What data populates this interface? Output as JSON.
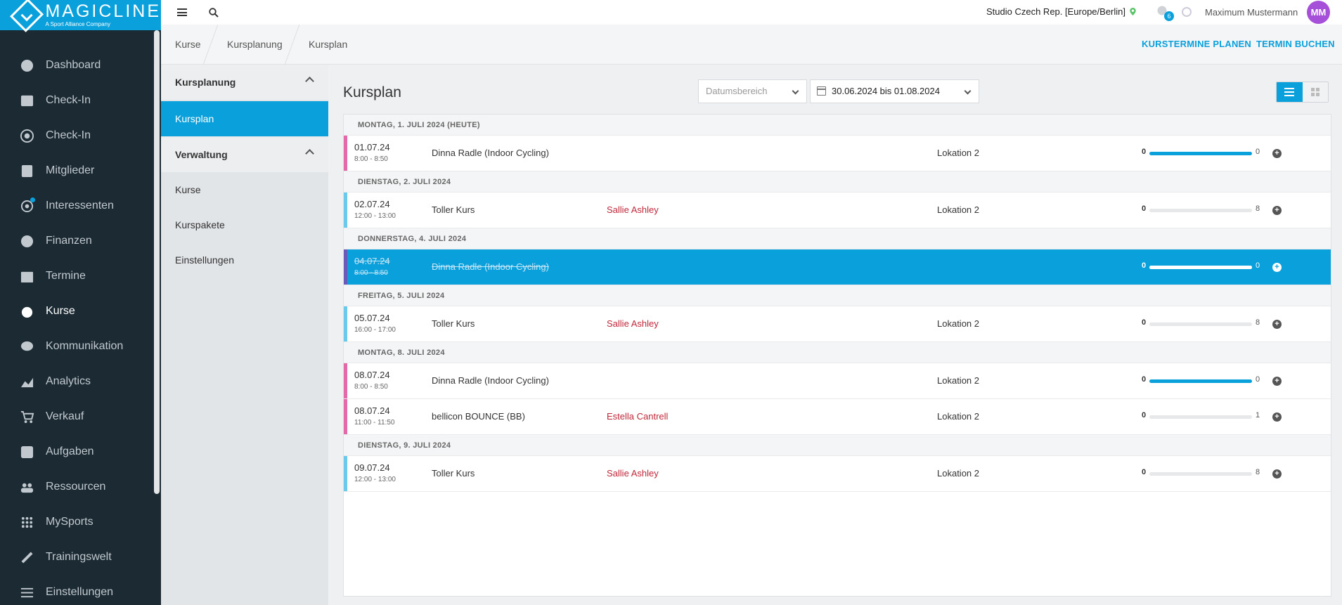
{
  "brand": {
    "name": "MAGICLINE",
    "tagline": "A Sport Alliance Company",
    "accent": "#0aa0dc",
    "sidebar_bg": "#1b2a33"
  },
  "sidebar": {
    "items": [
      {
        "label": "Dashboard",
        "icon": "dashboard-icon"
      },
      {
        "label": "Check-In",
        "icon": "checkin-icon"
      },
      {
        "label": "Check-In",
        "icon": "checkin-target-icon"
      },
      {
        "label": "Mitglieder",
        "icon": "members-icon"
      },
      {
        "label": "Interessenten",
        "icon": "prospects-icon"
      },
      {
        "label": "Finanzen",
        "icon": "euro-icon"
      },
      {
        "label": "Termine",
        "icon": "calendar-icon"
      },
      {
        "label": "Kurse",
        "icon": "courses-icon"
      },
      {
        "label": "Kommunikation",
        "icon": "chat-icon"
      },
      {
        "label": "Analytics",
        "icon": "analytics-icon"
      },
      {
        "label": "Verkauf",
        "icon": "cart-icon"
      },
      {
        "label": "Aufgaben",
        "icon": "tasks-icon"
      },
      {
        "label": "Ressourcen",
        "icon": "resources-icon"
      },
      {
        "label": "MySports",
        "icon": "mysports-icon"
      },
      {
        "label": "Trainingswelt",
        "icon": "training-icon"
      },
      {
        "label": "Einstellungen",
        "icon": "settings-icon"
      }
    ],
    "active": "Kurse"
  },
  "topbar": {
    "studio": "Studio Czech Rep. [Europe/Berlin]",
    "notifications": "6",
    "user": "Maximum Mustermann",
    "avatar": "MM"
  },
  "breadcrumb": [
    "Kurse",
    "Kursplanung",
    "Kursplan"
  ],
  "actions": {
    "plan": "KURSTERMINE PLANEN",
    "book": "TERMIN BUCHEN"
  },
  "subnav": {
    "group1": "Kursplanung",
    "group1_items": [
      "Kursplan"
    ],
    "group2": "Verwaltung",
    "group2_items": [
      "Kurse",
      "Kurspakete",
      "Einstellungen"
    ]
  },
  "main": {
    "title": "Kursplan",
    "date_type_placeholder": "Datumsbereich",
    "date_range": "30.06.2024 bis 01.08.2024"
  },
  "days": [
    {
      "header": "MONTAG, 1. JULI 2024 (HEUTE)",
      "rows": [
        {
          "date": "01.07.24",
          "time": "8:00  -  8:50",
          "name": "Dinna Radle (Indoor Cycling)",
          "trainer": "",
          "location": "Lokation 2",
          "booked": "0",
          "capacity": "0",
          "fill": 1.0,
          "color": "#e36aa9",
          "selected": false
        }
      ]
    },
    {
      "header": "DIENSTAG, 2. JULI 2024",
      "rows": [
        {
          "date": "02.07.24",
          "time": "12:00  -  13:00",
          "name": "Toller Kurs",
          "trainer": "Sallie Ashley",
          "location": "Lokation 2",
          "booked": "0",
          "capacity": "8",
          "fill": 0,
          "color": "#6cc9ec",
          "selected": false
        }
      ]
    },
    {
      "header": "DONNERSTAG, 4. JULI 2024",
      "rows": [
        {
          "date": "04.07.24",
          "time": "8:00  -  8:50",
          "name": "Dinna Radle (Indoor Cycling)",
          "trainer": "",
          "location": "",
          "booked": "0",
          "capacity": "0",
          "fill": 1.0,
          "color": "#6a5bb8",
          "selected": true
        }
      ]
    },
    {
      "header": "FREITAG, 5. JULI 2024",
      "rows": [
        {
          "date": "05.07.24",
          "time": "16:00  -  17:00",
          "name": "Toller Kurs",
          "trainer": "Sallie Ashley",
          "location": "Lokation 2",
          "booked": "0",
          "capacity": "8",
          "fill": 0,
          "color": "#6cc9ec",
          "selected": false
        }
      ]
    },
    {
      "header": "MONTAG, 8. JULI 2024",
      "rows": [
        {
          "date": "08.07.24",
          "time": "8:00  -  8:50",
          "name": "Dinna Radle (Indoor Cycling)",
          "trainer": "",
          "location": "Lokation 2",
          "booked": "0",
          "capacity": "0",
          "fill": 1.0,
          "color": "#e36aa9",
          "selected": false
        },
        {
          "date": "08.07.24",
          "time": "11:00  -  11:50",
          "name": "bellicon BOUNCE (BB)",
          "trainer": "Estella Cantrell",
          "location": "Lokation 2",
          "booked": "0",
          "capacity": "1",
          "fill": 0,
          "color": "#e36aa9",
          "selected": false
        }
      ]
    },
    {
      "header": "DIENSTAG, 9. JULI 2024",
      "rows": [
        {
          "date": "09.07.24",
          "time": "12:00  -  13:00",
          "name": "Toller Kurs",
          "trainer": "Sallie Ashley",
          "location": "Lokation 2",
          "booked": "0",
          "capacity": "8",
          "fill": 0,
          "color": "#6cc9ec",
          "selected": false
        }
      ]
    }
  ]
}
